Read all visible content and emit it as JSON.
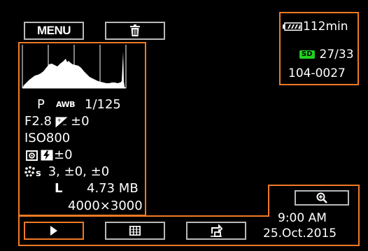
{
  "top_bar": {
    "menu_label": "MENU",
    "delete_icon": "trash-icon"
  },
  "status": {
    "battery_icon": "battery-icon",
    "battery_time": "112min",
    "sd_label": "SD",
    "image_counter": "27/33",
    "file_number": "104-0027"
  },
  "info": {
    "histogram_icon": "histogram-icon",
    "mode": "P",
    "white_balance_badge": "AWB",
    "shutter": "1/125",
    "aperture": "F2.8",
    "exposure_comp_icon": "exposure-compensation-icon",
    "exposure_comp": "±0",
    "iso": "ISO800",
    "metering_icon": "metering-icon",
    "flash_comp_icon": "flash-compensation-icon",
    "flash_comp": "±0",
    "image_effect_icon": "image-effect-icon",
    "image_effect_values": "3, ±0, ±0",
    "image_size_label": "L",
    "file_size": "4.73 MB",
    "resolution": "4000×3000"
  },
  "bottom": {
    "zoom_icon": "zoom-in-icon",
    "time": "9:00 AM",
    "date": "25.Oct.2015",
    "play_icon": "play-icon",
    "index_icon": "index-icon",
    "return_icon": "return-icon"
  },
  "colors": {
    "highlight": "#f07a25",
    "button_border": "#b9b9b9",
    "sd_badge": "#1fd21f"
  }
}
